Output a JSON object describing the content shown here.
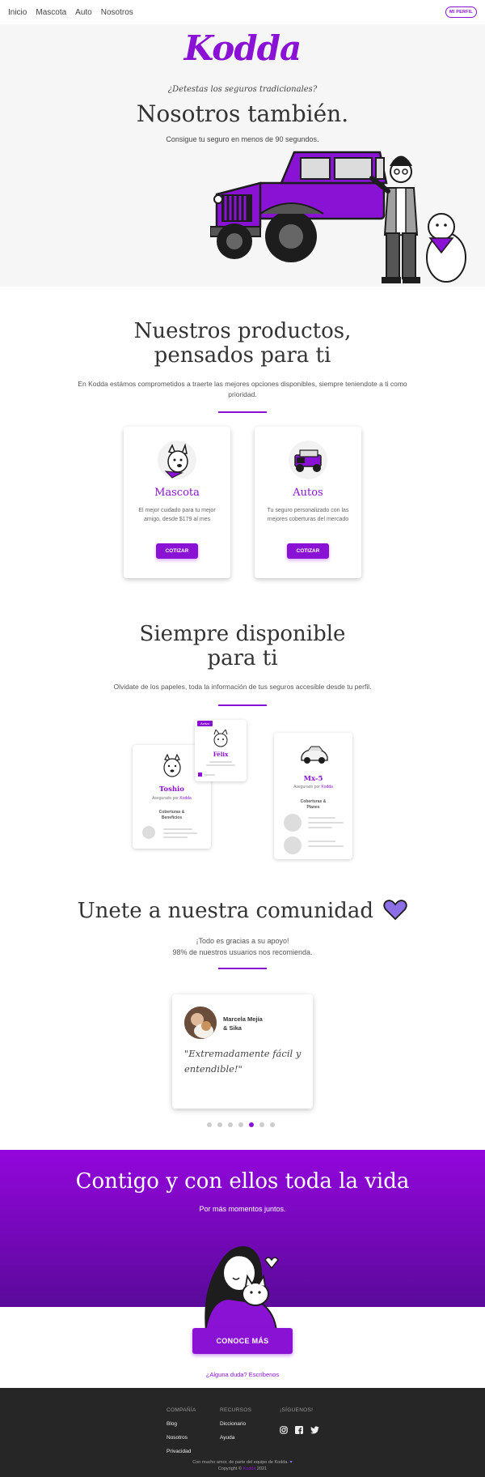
{
  "nav": {
    "items": [
      "Inicio",
      "Mascota",
      "Auto",
      "Nosotros"
    ],
    "profile_label": "MI PERFIL"
  },
  "hero": {
    "logo": "Kodda",
    "question": "¿Detestas los seguros tradicionales?",
    "headline": "Nosotros también.",
    "subtitle": "Consigue tu seguro en menos de 90 segundos."
  },
  "products": {
    "title_line1": "Nuestros productos,",
    "title_line2": "pensados para ti",
    "description": "En Kodda estámos comprometidos a traerte las mejores opciones disponibles, siempre teniendote a ti como prioridad.",
    "cards": [
      {
        "title": "Mascota",
        "desc": "El mejor cuidado para tu mejor amigo, desde $179 al mes",
        "button": "COTIZAR"
      },
      {
        "title": "Autos",
        "desc": "Tu seguro personalizado con las mejores coberturas del mercado",
        "button": "COTIZAR"
      }
    ]
  },
  "available": {
    "title_line1": "Siempre disponible",
    "title_line2": "para ti",
    "description": "Olvidate de los papeles, toda la información de tus seguros accesible desde tu perfil.",
    "phones": [
      {
        "name": "Toshio",
        "insured_prefix": "Asegurado por",
        "insured_brand": "Kodda",
        "coverage_line1": "Coberturas &",
        "coverage_line2": "Beneficios"
      },
      {
        "name": "Félix",
        "badge": "Activo"
      },
      {
        "name": "Mx-5",
        "insured_prefix": "Asegurado por",
        "insured_brand": "Kodda",
        "coverage_line1": "Coberturas &",
        "coverage_line2": "Planes"
      }
    ]
  },
  "community": {
    "title": "Unete a nuestra comunidad",
    "line1": "¡Todo es gracias a su apoyo!",
    "line2": "98% de nuestros usuarios nos recomienda.",
    "testimonial": {
      "name_line1": "Marcela Mejía",
      "name_line2": "& Sika",
      "quote": "\"Extremadamente fácil y entendible!\""
    },
    "carousel_active": 5,
    "carousel_count": 7
  },
  "cta": {
    "title": "Contigo y con ellos toda la vida",
    "subtitle": "Por más momentos juntos.",
    "button": "CONOCE MÁS",
    "doubt_link": "¿Alguna duda? Escríbenos"
  },
  "footer": {
    "company_heading": "COMPAÑÍA",
    "company_items": [
      "Blog",
      "Nosotros",
      "Privacidad"
    ],
    "resources_heading": "RECURSOS",
    "resources_items": [
      "Diccionario",
      "Ayuda"
    ],
    "social_heading": "¡SÍGUENOS!",
    "note_line1": "Con mucho amor, de parte del equipo de Kodda.",
    "note_line2_prefix": "Copyright ©",
    "note_brand": "Kodda",
    "note_year": "2021"
  },
  "colors": {
    "accent": "#8a12d4",
    "footer_bg": "#262626"
  }
}
